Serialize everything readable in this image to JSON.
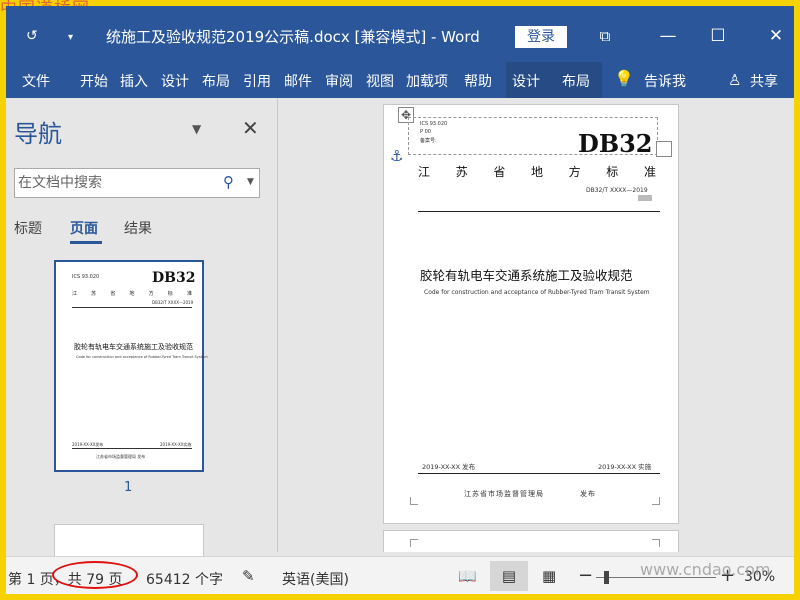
{
  "watermark": {
    "top_left": "中国道桥网",
    "bottom_right": "www.cndao.com"
  },
  "window": {
    "title": "统施工及验收规范2019公示稿.docx [兼容模式] - Word",
    "login_label": "登录",
    "controls": {
      "restore": "⧉",
      "minimize": "—",
      "maximize": "☐",
      "close": "✕"
    }
  },
  "ribbon": {
    "tabs": [
      "文件",
      "开始",
      "插入",
      "设计",
      "布局",
      "引用",
      "邮件",
      "审阅",
      "视图",
      "加载项",
      "帮助",
      "设计",
      "布局"
    ],
    "tell_me": "告诉我",
    "share": "共享"
  },
  "nav_pane": {
    "title": "导航",
    "search_placeholder": "在文档中搜索",
    "tabs": [
      "标题",
      "页面",
      "结果"
    ],
    "active_tab": "页面",
    "thumbnail_page_number": "1"
  },
  "thumbnail": {
    "code": "DB32",
    "province": [
      "江",
      "苏",
      "省",
      "地",
      "方",
      "标",
      "准"
    ],
    "doc_number": "DB32/T XXXX—2019",
    "title_cn": "胶轮有轨电车交通系统施工及验收规范",
    "title_en": "Code for construction and acceptance of Rubber-Tyred Tram Transit System",
    "issue_date": "2019-XX-XX发布",
    "impl_date": "2019-XX-XX实施",
    "issuer": "江苏省市场监督管理局 发布"
  },
  "document": {
    "header_small": [
      "ICS 93.020",
      "P 00",
      "备案号:"
    ],
    "code": "DB32",
    "province": [
      "江",
      "苏",
      "省",
      "地",
      "方",
      "标",
      "准"
    ],
    "doc_number": "DB32/T XXXX—2019",
    "title_cn": "胶轮有轨电车交通系统施工及验收规范",
    "title_en": "Code for construction and acceptance of Rubber-Tyred Tram Transit System",
    "issue_date": "2019-XX-XX 发布",
    "impl_date": "2019-XX-XX 实施",
    "issuer": "江苏省市场监督管理局",
    "issuer_suffix": "发布"
  },
  "status": {
    "page": "第 1 页，共 79 页",
    "words": "65412 个字",
    "language": "英语(美国)",
    "zoom": "30%",
    "zoom_level": 30
  },
  "colors": {
    "accent": "#2b579a",
    "frame": "#f6d200",
    "highlight": "#e01010"
  }
}
